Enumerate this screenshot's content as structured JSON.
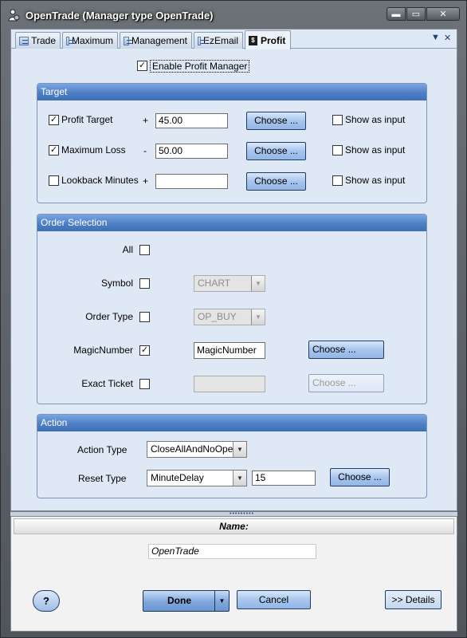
{
  "window": {
    "title": "OpenTrade (Manager type OpenTrade)",
    "icon": "person-gear-icon"
  },
  "tabs": [
    {
      "label": "Trade",
      "icon": "form-icon",
      "active": false
    },
    {
      "label": "Maximum",
      "icon": "form-icon",
      "active": false
    },
    {
      "label": "Management",
      "icon": "form-icon",
      "active": false
    },
    {
      "label": "EzEmail",
      "icon": "form-icon",
      "active": false
    },
    {
      "label": "Profit",
      "icon": "dollar-icon",
      "active": true
    }
  ],
  "profit": {
    "enable_label": "Enable Profit Manager",
    "enable_checked": true,
    "target": {
      "title": "Target",
      "rows": [
        {
          "label": "Profit Target",
          "checked": true,
          "sign": "+",
          "value": "45.00",
          "choose": "Choose ...",
          "show_label": "Show as input",
          "show_checked": false
        },
        {
          "label": "Maximum Loss",
          "checked": true,
          "sign": "-",
          "value": "50.00",
          "choose": "Choose ...",
          "show_label": "Show as input",
          "show_checked": false
        },
        {
          "label": "Lookback Minutes",
          "checked": false,
          "sign": "+",
          "value": "",
          "choose": "Choose ...",
          "show_label": "Show as input",
          "show_checked": false
        }
      ]
    },
    "order_selection": {
      "title": "Order Selection",
      "all_label": "All",
      "all_checked": false,
      "symbol_label": "Symbol",
      "symbol_checked": false,
      "symbol_value": "CHART",
      "order_type_label": "Order Type",
      "order_type_checked": false,
      "order_type_value": "OP_BUY",
      "magic_label": "MagicNumber",
      "magic_checked": true,
      "magic_value": "MagicNumber",
      "magic_choose": "Choose ...",
      "ticket_label": "Exact Ticket",
      "ticket_checked": false,
      "ticket_value": "",
      "ticket_choose": "Choose ..."
    },
    "action": {
      "title": "Action",
      "action_type_label": "Action Type",
      "action_type_value": "CloseAllAndNoOpen",
      "reset_type_label": "Reset Type",
      "reset_type_value": "MinuteDelay",
      "reset_value": "15",
      "choose": "Choose ..."
    }
  },
  "bottom": {
    "name_header": "Name:",
    "name_value": "OpenTrade",
    "help_label": "?",
    "done_label": "Done",
    "cancel_label": "Cancel",
    "details_label": ">> Details"
  }
}
